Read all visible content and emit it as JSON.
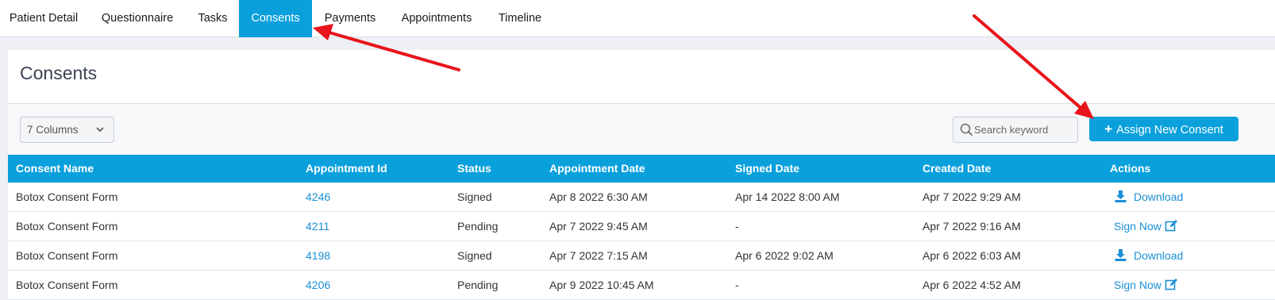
{
  "tabs": [
    {
      "label": "Patient Detail",
      "active": false
    },
    {
      "label": "Questionnaire",
      "active": false
    },
    {
      "label": "Tasks",
      "active": false
    },
    {
      "label": "Consents",
      "active": true
    },
    {
      "label": "Payments",
      "active": false
    },
    {
      "label": "Appointments",
      "active": false
    },
    {
      "label": "Timeline",
      "active": false
    }
  ],
  "page": {
    "title": "Consents"
  },
  "toolbar": {
    "columns_value": "7 Columns",
    "search_placeholder": "Search keyword",
    "assign_label": "Assign New Consent"
  },
  "table": {
    "headers": [
      "Consent Name",
      "Appointment Id",
      "Status",
      "Appointment Date",
      "Signed Date",
      "Created Date",
      "Actions"
    ],
    "rows": [
      {
        "name": "Botox Consent Form",
        "appointment_id": "4246",
        "status": "Signed",
        "appointment_date": "Apr 8 2022 6:30 AM",
        "signed_date": "Apr 14 2022 8:00 AM",
        "created_date": "Apr 7 2022 9:29 AM",
        "action": "Download"
      },
      {
        "name": "Botox Consent Form",
        "appointment_id": "4211",
        "status": "Pending",
        "appointment_date": "Apr 7 2022 9:45 AM",
        "signed_date": "-",
        "created_date": "Apr 7 2022 9:16 AM",
        "action": "Sign Now"
      },
      {
        "name": "Botox Consent Form",
        "appointment_id": "4198",
        "status": "Signed",
        "appointment_date": "Apr 7 2022 7:15 AM",
        "signed_date": "Apr 6 2022 9:02 AM",
        "created_date": "Apr 6 2022 6:03 AM",
        "action": "Download"
      },
      {
        "name": "Botox Consent Form",
        "appointment_id": "4206",
        "status": "Pending",
        "appointment_date": "Apr 9 2022 10:45 AM",
        "signed_date": "-",
        "created_date": "Apr 6 2022 4:52 AM",
        "action": "Sign Now"
      }
    ]
  },
  "colors": {
    "accent": "#0aa0dc",
    "link": "#1a8fd6",
    "annotation": "#e8141b"
  },
  "icons": {
    "columns": "chevron-down-icon",
    "search": "search-icon",
    "assign": "plus-icon",
    "download": "download-icon",
    "sign": "edit-icon"
  }
}
